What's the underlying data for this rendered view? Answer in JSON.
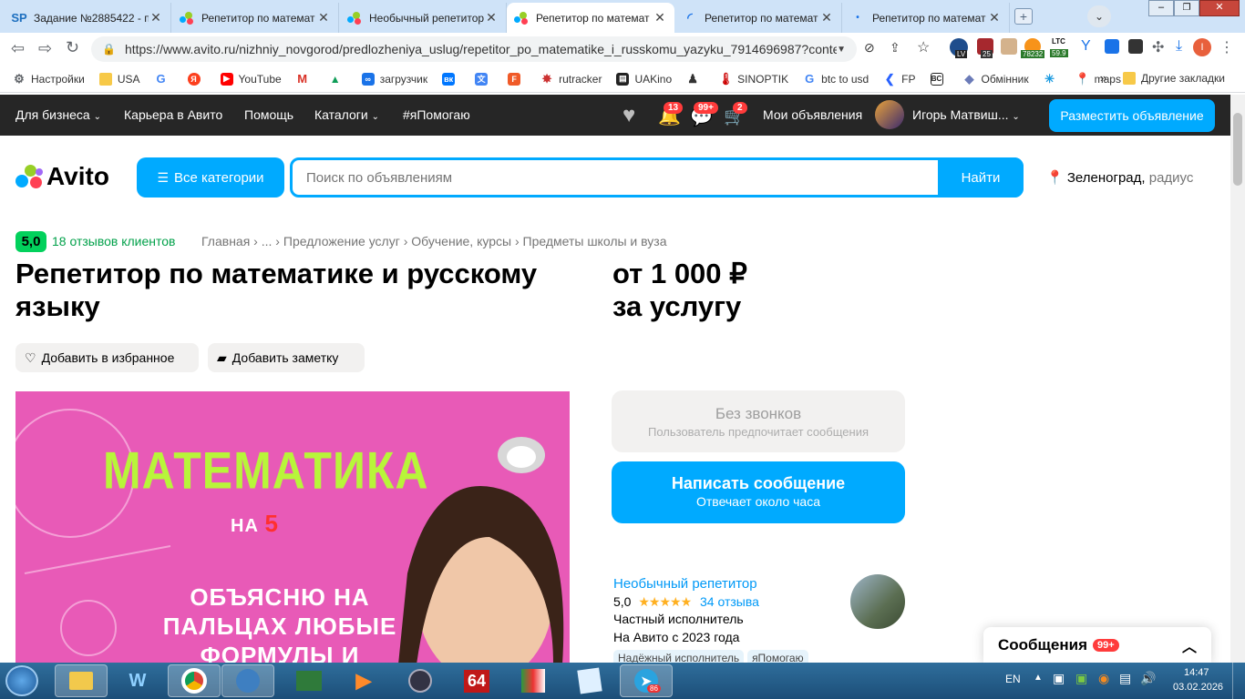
{
  "browser": {
    "tabs": [
      {
        "icon": "SP",
        "title": "Задание №2885422 - п"
      },
      {
        "icon": "avito",
        "title": "Репетитор по математ"
      },
      {
        "icon": "avito",
        "title": "Необычный репетитор"
      },
      {
        "icon": "avito",
        "title": "Репетитор по математ"
      },
      {
        "icon": "loading",
        "title": "Репетитор по математ"
      },
      {
        "icon": "dot",
        "title": "Репетитор по математ"
      }
    ],
    "url": "https://www.avito.ru/nizhniy_novgorod/predlozheniya_uslug/repetitor_po_matematike_i_russkomu_yazyku_7914696987?conte...",
    "ext_labels": [
      "LV",
      "25",
      "78232",
      "LTC",
      "59.9"
    ],
    "bookmarks": [
      "Настройки",
      "USA",
      "",
      "",
      "YouTube",
      "",
      "",
      "загрузчик",
      "",
      "",
      "",
      "rutracker",
      "UAKino",
      "",
      "SINOPTIK",
      "btc to usd",
      "FP",
      "",
      "Обмінник",
      "",
      "maps"
    ],
    "bookmarks_more": "»",
    "other_bookmarks": "Другие закладки"
  },
  "avito_header": {
    "links": [
      "Для бизнеса",
      "Карьера в Авито",
      "Помощь",
      "Каталоги",
      "#яПомогаю"
    ],
    "notif_badge": "13",
    "msg_badge": "99+",
    "cart_badge": "2",
    "my_ads": "Мои объявления",
    "user_name": "Игорь Матвиш...",
    "post_button": "Разместить объявление"
  },
  "search": {
    "logo": "Avito",
    "categories_button": "Все категории",
    "placeholder": "Поиск по объявлениям",
    "find_button": "Найти",
    "location_city": "Зеленоград,",
    "location_radius": "радиус"
  },
  "listing": {
    "rating": "5,0",
    "reviews_link": "18 отзывов клиентов",
    "breadcrumbs": [
      "Главная",
      "...",
      "Предложение услуг",
      "Обучение, курсы",
      "Предметы школы и вуза"
    ],
    "title": "Репетитор по математике и русскому языку",
    "price_line1": "от 1 000 ₽",
    "price_line2": "за услугу",
    "favorite_button": "Добавить в избранное",
    "note_button": "Добавить заметку",
    "photo_text": {
      "headline": "МАТЕМАТИКА",
      "sub": "НА",
      "grade": "5",
      "lines": [
        "ОБЪЯСНЮ НА",
        "ПАЛЬЦАХ ЛЮБЫЕ",
        "ФОРМУЛЫ И"
      ]
    }
  },
  "contact": {
    "no_calls_title": "Без звонков",
    "no_calls_sub": "Пользователь предпочитает сообщения",
    "write_title": "Написать сообщение",
    "write_sub": "Отвечает около часа"
  },
  "seller": {
    "name": "Необычный репетитор",
    "rating": "5,0",
    "stars": 5,
    "reviews": "34 отзыва",
    "type": "Частный исполнитель",
    "since": "На Авито с 2023 года",
    "tags": [
      "Надёжный исполнитель",
      "яПомогаю"
    ]
  },
  "messages_widget": {
    "label": "Сообщения",
    "badge": "99+"
  },
  "taskbar": {
    "lang": "EN",
    "time": "14:47",
    "date": "03.02.2026",
    "telegram_badge": "86",
    "app64": "64"
  }
}
